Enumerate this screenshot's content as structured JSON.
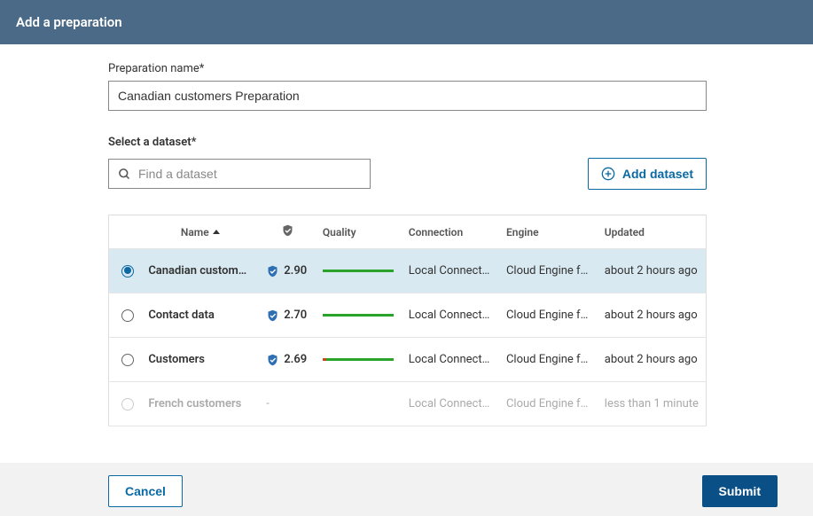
{
  "header": {
    "title": "Add a preparation"
  },
  "form": {
    "name_label": "Preparation name*",
    "name_value": "Canadian customers Preparation",
    "dataset_section_label": "Select a dataset*",
    "search_placeholder": "Find a dataset",
    "add_dataset_label": "Add dataset"
  },
  "table": {
    "headers": {
      "name": "Name",
      "quality": "Quality",
      "connection": "Connection",
      "engine": "Engine",
      "updated": "Updated"
    },
    "rows": [
      {
        "selected": true,
        "name": "Canadian custom…",
        "trust": "2.90",
        "quality_variant": "full",
        "connection": "Local Connect…",
        "engine": "Cloud Engine f…",
        "updated": "about 2 hours ago"
      },
      {
        "selected": false,
        "name": "Contact data",
        "trust": "2.70",
        "quality_variant": "full",
        "connection": "Local Connect…",
        "engine": "Cloud Engine f…",
        "updated": "about 2 hours ago"
      },
      {
        "selected": false,
        "name": "Customers",
        "trust": "2.69",
        "quality_variant": "split",
        "connection": "Local Connect…",
        "engine": "Cloud Engine f…",
        "updated": "about 2 hours ago"
      },
      {
        "selected": false,
        "disabled": true,
        "name": "French customers",
        "trust": "-",
        "quality_variant": "none",
        "connection": "Local Connect…",
        "engine": "Cloud Engine f…",
        "updated": "less than 1 minute"
      }
    ]
  },
  "footer": {
    "cancel": "Cancel",
    "submit": "Submit"
  }
}
